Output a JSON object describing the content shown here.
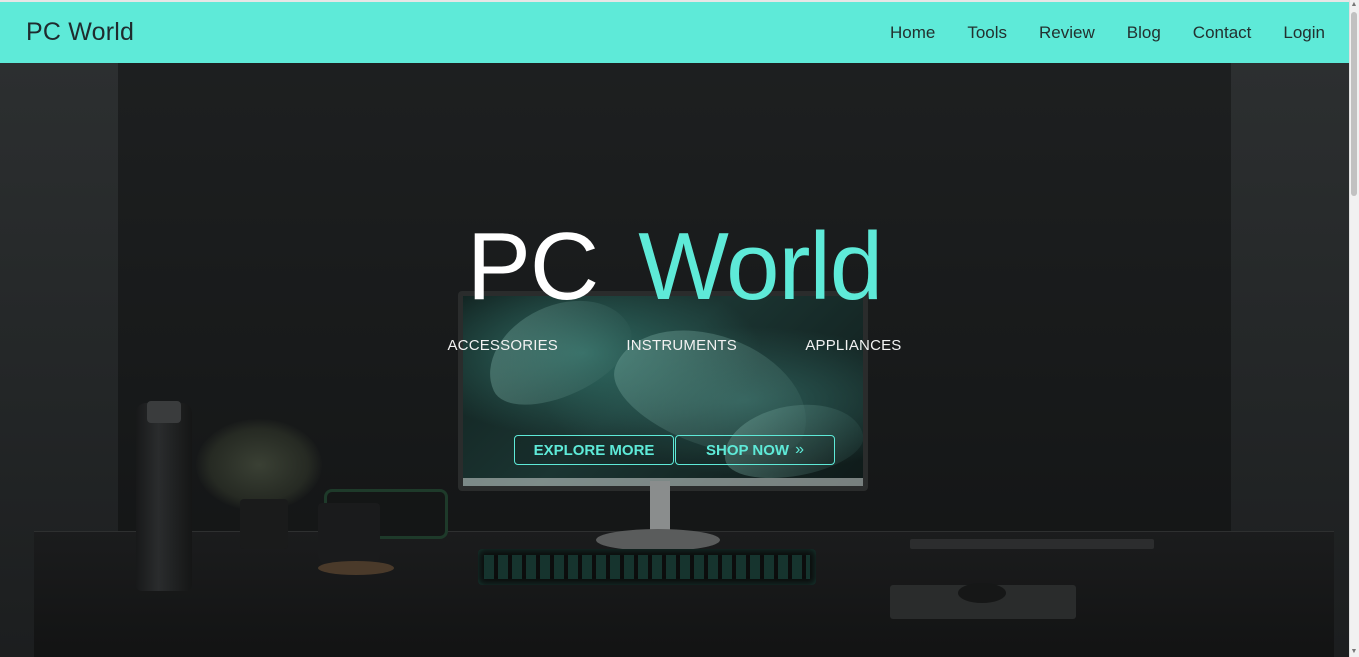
{
  "navbar": {
    "brand": "PC World",
    "links": [
      "Home",
      "Tools",
      "Review",
      "Blog",
      "Contact",
      "Login"
    ]
  },
  "hero": {
    "title_part1": "PC",
    "title_part2": "World",
    "categories": [
      "ACCESSORIES",
      "INSTRUMENTS",
      "APPLIANCES"
    ],
    "buttons": {
      "explore": "EXPLORE MORE",
      "shop": "SHOP NOW"
    }
  },
  "icons": {
    "shop_chevron": "double-chevron-right-icon",
    "scroll_up": "triangle-up-icon",
    "scroll_down": "triangle-down-icon"
  },
  "colors": {
    "accent": "#5eead8",
    "navbar_bg": "#5eead8",
    "hero_bg": "#2a2d2e",
    "text_dark": "#1f2b2e",
    "text_light": "#ffffff"
  }
}
